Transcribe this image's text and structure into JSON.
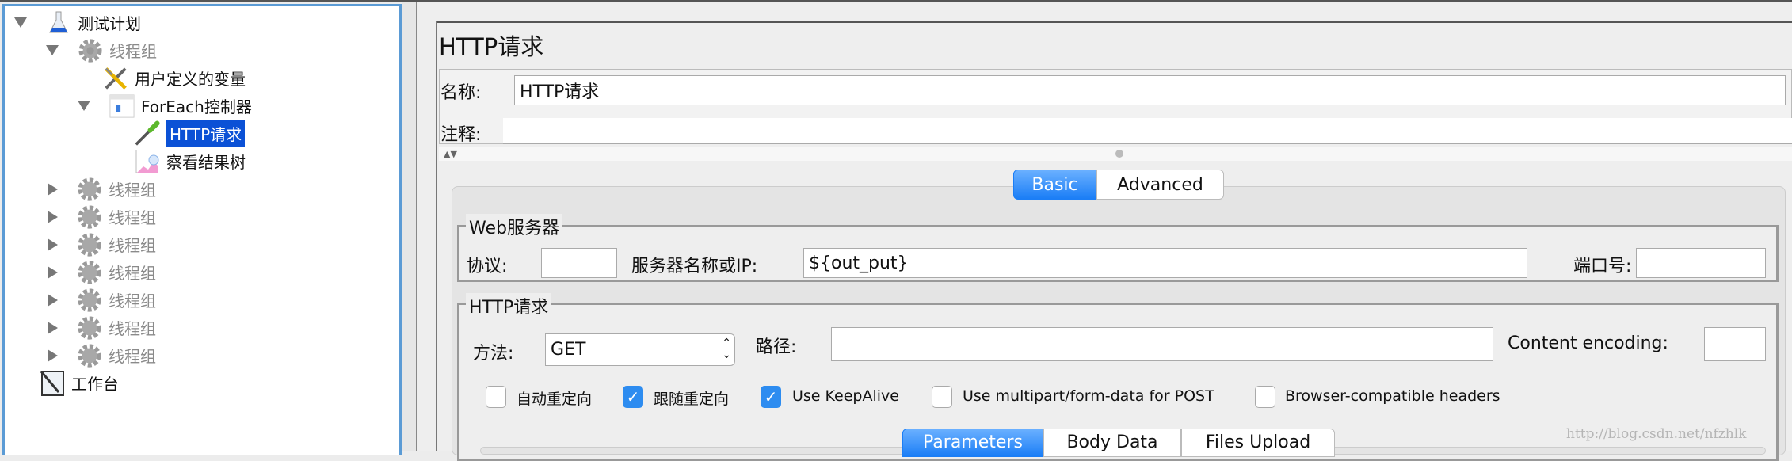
{
  "tree": {
    "items": [
      {
        "label": "测试计划",
        "icon": "flask-icon"
      },
      {
        "label": "线程组",
        "icon": "gear-icon"
      },
      {
        "label": "用户定义的变量",
        "icon": "tools-icon"
      },
      {
        "label": "ForEach控制器",
        "icon": "foreach-controller-icon"
      },
      {
        "label": "HTTP请求",
        "icon": "dropper-icon"
      },
      {
        "label": "察看结果树",
        "icon": "chart-icon"
      },
      {
        "label": "线程组"
      },
      {
        "label": "线程组"
      },
      {
        "label": "线程组"
      },
      {
        "label": "线程组"
      },
      {
        "label": "线程组"
      },
      {
        "label": "线程组"
      },
      {
        "label": "线程组"
      },
      {
        "label": "工作台",
        "icon": "notepad-icon"
      }
    ]
  },
  "panel": {
    "title": "HTTP请求",
    "name_label": "名称:",
    "name_value": "HTTP请求",
    "comment_label": "注释:",
    "comment_value": "",
    "tabs": [
      "Basic",
      "Advanced"
    ],
    "web_server": {
      "legend": "Web服务器",
      "protocol_label": "协议:",
      "protocol_value": "",
      "server_label": "服务器名称或IP:",
      "server_value": "${out_put}",
      "port_label": "端口号:",
      "port_value": ""
    },
    "http_request": {
      "legend": "HTTP请求",
      "method_label": "方法:",
      "method_value": "GET",
      "path_label": "路径:",
      "path_value": "",
      "encoding_label": "Content encoding:",
      "encoding_value": "",
      "checkboxes": [
        {
          "label": "自动重定向",
          "checked": false
        },
        {
          "label": "跟随重定向",
          "checked": true
        },
        {
          "label": "Use KeepAlive",
          "checked": true
        },
        {
          "label": "Use multipart/form-data for POST",
          "checked": false
        },
        {
          "label": "Browser-compatible headers",
          "checked": false
        }
      ],
      "subtabs": [
        "Parameters",
        "Body Data",
        "Files Upload"
      ]
    }
  },
  "watermark": "http://blog.csdn.net/nfzhlk",
  "colors": {
    "selection": "#0b51d6",
    "accent": "#1b7ef6",
    "tree_border": "#5b9bd5"
  }
}
